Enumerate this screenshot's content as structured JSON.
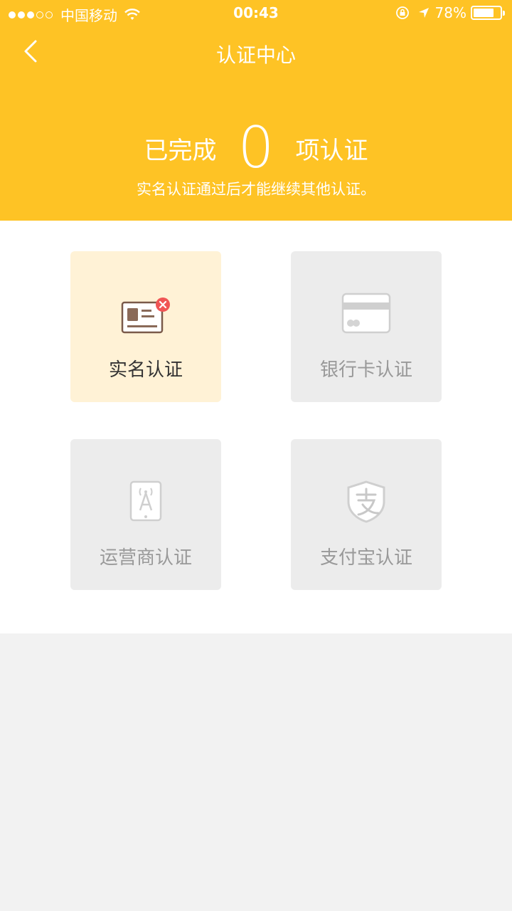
{
  "status": {
    "carrier": "中国移动",
    "time": "00:43",
    "battery": "78%",
    "battery_level": 0.78
  },
  "nav": {
    "title": "认证中心"
  },
  "summary": {
    "prefix": "已完成",
    "count": "0",
    "suffix": "项认证",
    "note": "实名认证通过后才能继续其他认证。"
  },
  "cards": [
    {
      "label": "实名认证",
      "icon": "id-card-icon",
      "state": "active"
    },
    {
      "label": "银行卡认证",
      "icon": "bank-card-icon",
      "state": "disabled"
    },
    {
      "label": "运营商认证",
      "icon": "mobile-signal-icon",
      "state": "disabled"
    },
    {
      "label": "支付宝认证",
      "icon": "alipay-icon",
      "state": "disabled"
    }
  ],
  "colors": {
    "accent": "#fec325",
    "active_card": "#fff2d6",
    "disabled_card": "#ececec",
    "error_badge": "#f05555"
  }
}
